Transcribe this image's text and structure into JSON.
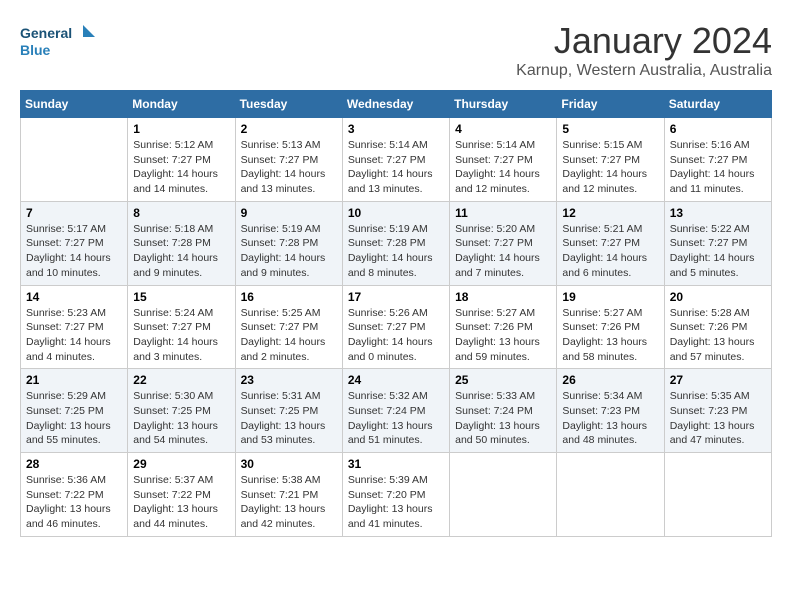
{
  "header": {
    "logo_general": "General",
    "logo_blue": "Blue",
    "month_title": "January 2024",
    "location": "Karnup, Western Australia, Australia"
  },
  "weekdays": [
    "Sunday",
    "Monday",
    "Tuesday",
    "Wednesday",
    "Thursday",
    "Friday",
    "Saturday"
  ],
  "weeks": [
    [
      {
        "day": "",
        "info": ""
      },
      {
        "day": "1",
        "info": "Sunrise: 5:12 AM\nSunset: 7:27 PM\nDaylight: 14 hours\nand 14 minutes."
      },
      {
        "day": "2",
        "info": "Sunrise: 5:13 AM\nSunset: 7:27 PM\nDaylight: 14 hours\nand 13 minutes."
      },
      {
        "day": "3",
        "info": "Sunrise: 5:14 AM\nSunset: 7:27 PM\nDaylight: 14 hours\nand 13 minutes."
      },
      {
        "day": "4",
        "info": "Sunrise: 5:14 AM\nSunset: 7:27 PM\nDaylight: 14 hours\nand 12 minutes."
      },
      {
        "day": "5",
        "info": "Sunrise: 5:15 AM\nSunset: 7:27 PM\nDaylight: 14 hours\nand 12 minutes."
      },
      {
        "day": "6",
        "info": "Sunrise: 5:16 AM\nSunset: 7:27 PM\nDaylight: 14 hours\nand 11 minutes."
      }
    ],
    [
      {
        "day": "7",
        "info": "Sunrise: 5:17 AM\nSunset: 7:27 PM\nDaylight: 14 hours\nand 10 minutes."
      },
      {
        "day": "8",
        "info": "Sunrise: 5:18 AM\nSunset: 7:28 PM\nDaylight: 14 hours\nand 9 minutes."
      },
      {
        "day": "9",
        "info": "Sunrise: 5:19 AM\nSunset: 7:28 PM\nDaylight: 14 hours\nand 9 minutes."
      },
      {
        "day": "10",
        "info": "Sunrise: 5:19 AM\nSunset: 7:28 PM\nDaylight: 14 hours\nand 8 minutes."
      },
      {
        "day": "11",
        "info": "Sunrise: 5:20 AM\nSunset: 7:27 PM\nDaylight: 14 hours\nand 7 minutes."
      },
      {
        "day": "12",
        "info": "Sunrise: 5:21 AM\nSunset: 7:27 PM\nDaylight: 14 hours\nand 6 minutes."
      },
      {
        "day": "13",
        "info": "Sunrise: 5:22 AM\nSunset: 7:27 PM\nDaylight: 14 hours\nand 5 minutes."
      }
    ],
    [
      {
        "day": "14",
        "info": "Sunrise: 5:23 AM\nSunset: 7:27 PM\nDaylight: 14 hours\nand 4 minutes."
      },
      {
        "day": "15",
        "info": "Sunrise: 5:24 AM\nSunset: 7:27 PM\nDaylight: 14 hours\nand 3 minutes."
      },
      {
        "day": "16",
        "info": "Sunrise: 5:25 AM\nSunset: 7:27 PM\nDaylight: 14 hours\nand 2 minutes."
      },
      {
        "day": "17",
        "info": "Sunrise: 5:26 AM\nSunset: 7:27 PM\nDaylight: 14 hours\nand 0 minutes."
      },
      {
        "day": "18",
        "info": "Sunrise: 5:27 AM\nSunset: 7:26 PM\nDaylight: 13 hours\nand 59 minutes."
      },
      {
        "day": "19",
        "info": "Sunrise: 5:27 AM\nSunset: 7:26 PM\nDaylight: 13 hours\nand 58 minutes."
      },
      {
        "day": "20",
        "info": "Sunrise: 5:28 AM\nSunset: 7:26 PM\nDaylight: 13 hours\nand 57 minutes."
      }
    ],
    [
      {
        "day": "21",
        "info": "Sunrise: 5:29 AM\nSunset: 7:25 PM\nDaylight: 13 hours\nand 55 minutes."
      },
      {
        "day": "22",
        "info": "Sunrise: 5:30 AM\nSunset: 7:25 PM\nDaylight: 13 hours\nand 54 minutes."
      },
      {
        "day": "23",
        "info": "Sunrise: 5:31 AM\nSunset: 7:25 PM\nDaylight: 13 hours\nand 53 minutes."
      },
      {
        "day": "24",
        "info": "Sunrise: 5:32 AM\nSunset: 7:24 PM\nDaylight: 13 hours\nand 51 minutes."
      },
      {
        "day": "25",
        "info": "Sunrise: 5:33 AM\nSunset: 7:24 PM\nDaylight: 13 hours\nand 50 minutes."
      },
      {
        "day": "26",
        "info": "Sunrise: 5:34 AM\nSunset: 7:23 PM\nDaylight: 13 hours\nand 48 minutes."
      },
      {
        "day": "27",
        "info": "Sunrise: 5:35 AM\nSunset: 7:23 PM\nDaylight: 13 hours\nand 47 minutes."
      }
    ],
    [
      {
        "day": "28",
        "info": "Sunrise: 5:36 AM\nSunset: 7:22 PM\nDaylight: 13 hours\nand 46 minutes."
      },
      {
        "day": "29",
        "info": "Sunrise: 5:37 AM\nSunset: 7:22 PM\nDaylight: 13 hours\nand 44 minutes."
      },
      {
        "day": "30",
        "info": "Sunrise: 5:38 AM\nSunset: 7:21 PM\nDaylight: 13 hours\nand 42 minutes."
      },
      {
        "day": "31",
        "info": "Sunrise: 5:39 AM\nSunset: 7:20 PM\nDaylight: 13 hours\nand 41 minutes."
      },
      {
        "day": "",
        "info": ""
      },
      {
        "day": "",
        "info": ""
      },
      {
        "day": "",
        "info": ""
      }
    ]
  ]
}
